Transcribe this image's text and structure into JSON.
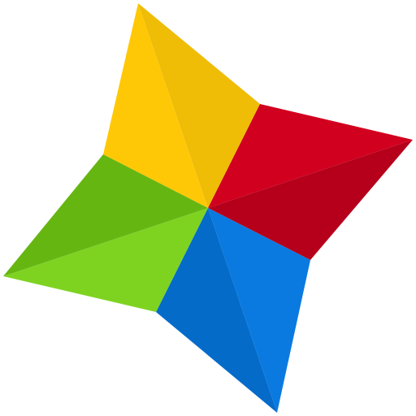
{
  "logo": {
    "shape": "four-point-star",
    "icon": "pinwheel-star-logo-icon",
    "background": "#ffffff",
    "blades": [
      {
        "name": "yellow",
        "light": "#FFC806",
        "dark": "#EFBC06"
      },
      {
        "name": "red",
        "light": "#D1001F",
        "dark": "#B6001B"
      },
      {
        "name": "blue",
        "light": "#0A7AE0",
        "dark": "#056BC9"
      },
      {
        "name": "green",
        "light": "#7ED321",
        "dark": "#66B612"
      }
    ]
  }
}
